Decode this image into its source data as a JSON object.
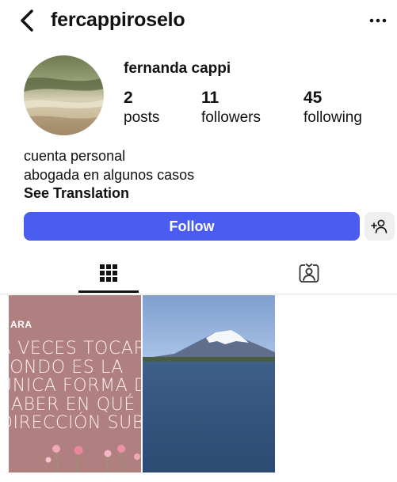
{
  "header": {
    "username": "fercappiroselo",
    "back_icon": "chevron-left-icon",
    "more_icon": "ellipsis-icon"
  },
  "profile": {
    "display_name": "fernanda cappi",
    "stats": {
      "posts": {
        "value": "2",
        "label": "posts"
      },
      "followers": {
        "value": "11",
        "label": "followers"
      },
      "following": {
        "value": "45",
        "label": "following"
      }
    },
    "bio_lines": [
      "cuenta personal",
      "abogada en algunos casos"
    ],
    "see_translation": "See Translation"
  },
  "actions": {
    "follow_label": "Follow",
    "follow_color": "#4a5df0",
    "suggest_icon": "add-person-icon"
  },
  "tabs": [
    {
      "name": "grid",
      "icon": "grid-icon",
      "active": true
    },
    {
      "name": "tagged",
      "icon": "tagged-person-icon",
      "active": false
    }
  ],
  "posts": [
    {
      "tag": "ARA",
      "text": "A VECES TOCAR\nFONDO ES LA\nÚNICA FORMA DE\nSABER EN QUÉ\nDIRECCIÓN SUBIR"
    },
    {
      "subject": "snow-capped volcano over lake"
    }
  ]
}
